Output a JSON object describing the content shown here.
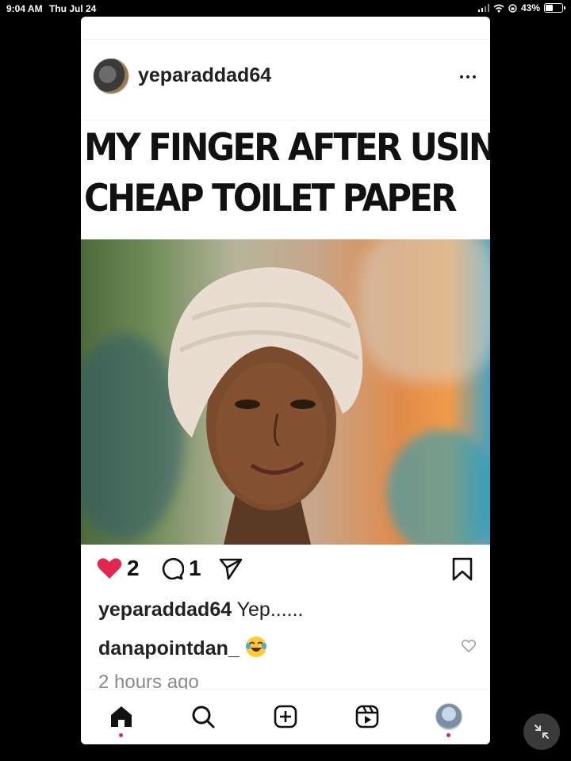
{
  "status_bar": {
    "time": "9:04 AM",
    "date": "Thu Jul 24",
    "battery": "43%",
    "battery_level": 0.43
  },
  "post": {
    "username": "yeparaddad64",
    "meme_lines": [
      "MY FINGER AFTER USING",
      "CHEAP TOILET PAPER"
    ],
    "like_count": "2",
    "comment_count": "1",
    "caption_user": "yeparaddad64",
    "caption_text": "Yep......",
    "comment_user": "danapointdan_",
    "comment_emoji": "😂",
    "time_ago": "2 hours ago"
  },
  "colors": {
    "like_red": "#e0284f",
    "background": "#000000",
    "card": "#ffffff"
  },
  "bottom_nav": {
    "items": [
      "home-icon",
      "search-icon",
      "create-icon",
      "reels-icon",
      "profile-avatar"
    ]
  }
}
